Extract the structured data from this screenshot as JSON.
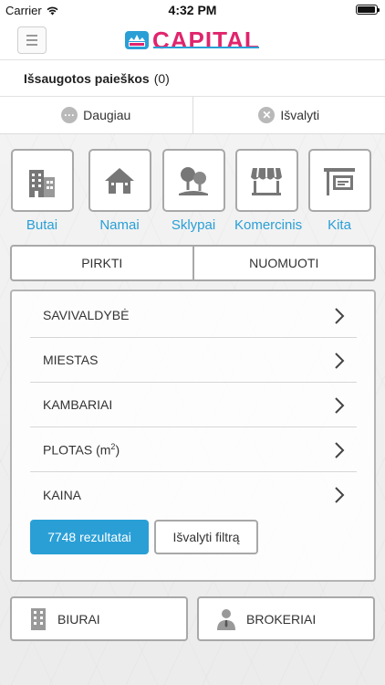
{
  "status_bar": {
    "carrier": "Carrier",
    "time": "4:32 PM"
  },
  "header": {
    "logo_text": "CAPITAL",
    "brand_color": "#e0256d",
    "accent_color": "#2a9fd6"
  },
  "saved_searches": {
    "label": "Išsaugotos paieškos",
    "count": "(0)"
  },
  "actions": {
    "more": {
      "label": "Daugiau",
      "icon": "more-icon"
    },
    "clear": {
      "label": "Išvalyti",
      "icon": "clear-icon"
    }
  },
  "property_types": [
    {
      "label": "Butai",
      "icon": "apartment-building-icon"
    },
    {
      "label": "Namai",
      "icon": "house-icon"
    },
    {
      "label": "Sklypai",
      "icon": "land-trees-icon"
    },
    {
      "label": "Komercinis",
      "icon": "shop-awning-icon"
    },
    {
      "label": "Kita",
      "icon": "sign-board-icon"
    }
  ],
  "deal_type": {
    "buy": "PIRKTI",
    "rent": "NUOMUOTI"
  },
  "filters": [
    {
      "label": "SAVIVALDYBĖ"
    },
    {
      "label": "MIESTAS"
    },
    {
      "label": "KAMBARIAI"
    },
    {
      "label": "PLOTAS (m",
      "sup": "2",
      "tail": ")"
    },
    {
      "label": "KAINA"
    }
  ],
  "results_button": "7748 rezultatai",
  "clear_filter_button": "Išvalyti filtrą",
  "bottom": {
    "offices": "BIURAI",
    "brokers": "BROKERIAI"
  }
}
